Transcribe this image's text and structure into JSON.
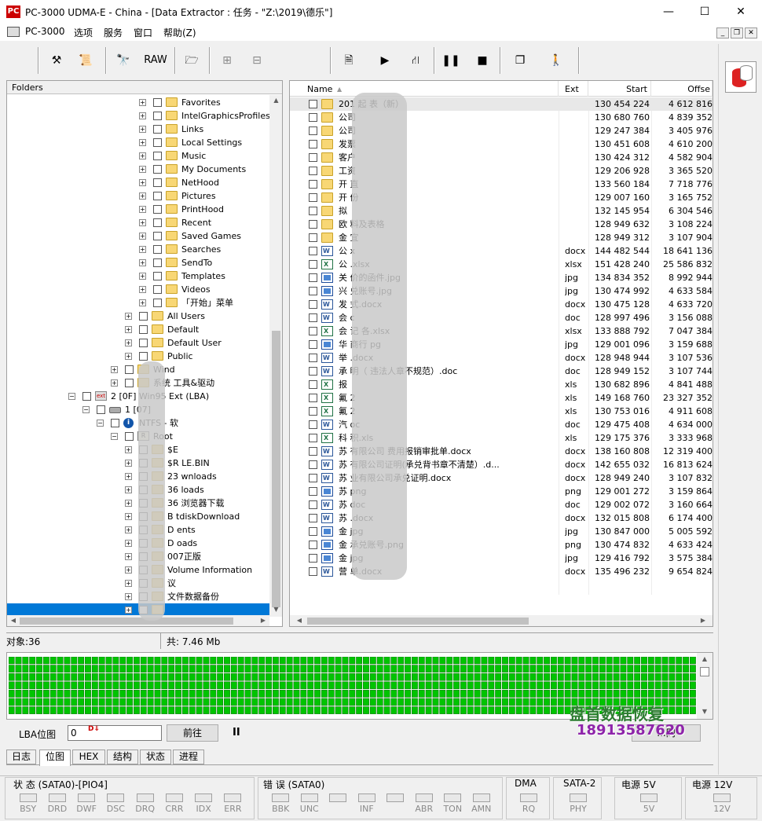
{
  "window": {
    "title": "PC-3000 UDMA-E - China - [Data Extractor : 任务 - \"Z:\\2019\\德乐\"]",
    "icon_text": "PC",
    "minimize_label": "—",
    "maximize_label": "☐",
    "close_label": "✕"
  },
  "menu": {
    "items": [
      "PC-3000",
      "选项",
      "服务",
      "窗口",
      "帮助(Z)"
    ]
  },
  "toolbar": {
    "raw_label": "RAW",
    "icons": [
      "tools-icon",
      "scroll-icon",
      "binoculars-icon",
      "raw-button",
      "folder-export-icon",
      "tree-icon",
      "tree-link-icon",
      "export-icon",
      "play-icon",
      "network-icon",
      "pause-icon",
      "stop-icon",
      "windows-icon",
      "exit-icon"
    ]
  },
  "folders": {
    "header": "Folders",
    "rows": [
      {
        "label": "Favorites",
        "level": 6,
        "icon": "folder"
      },
      {
        "label": "IntelGraphicsProfiles",
        "level": 6,
        "icon": "folder"
      },
      {
        "label": "Links",
        "level": 6,
        "icon": "folder"
      },
      {
        "label": "Local Settings",
        "level": 6,
        "icon": "folder"
      },
      {
        "label": "Music",
        "level": 6,
        "icon": "folder"
      },
      {
        "label": "My Documents",
        "level": 6,
        "icon": "folder"
      },
      {
        "label": "NetHood",
        "level": 6,
        "icon": "folder"
      },
      {
        "label": "Pictures",
        "level": 6,
        "icon": "folder"
      },
      {
        "label": "PrintHood",
        "level": 6,
        "icon": "folder"
      },
      {
        "label": "Recent",
        "level": 6,
        "icon": "folder"
      },
      {
        "label": "Saved Games",
        "level": 6,
        "icon": "folder"
      },
      {
        "label": "Searches",
        "level": 6,
        "icon": "folder"
      },
      {
        "label": "SendTo",
        "level": 6,
        "icon": "folder"
      },
      {
        "label": "Templates",
        "level": 6,
        "icon": "folder"
      },
      {
        "label": "Videos",
        "level": 6,
        "icon": "folder"
      },
      {
        "label": "「开始」菜单",
        "level": 6,
        "icon": "folder"
      },
      {
        "label": "All Users",
        "level": 5,
        "icon": "folder"
      },
      {
        "label": "Default",
        "level": 5,
        "icon": "folder"
      },
      {
        "label": "Default User",
        "level": 5,
        "icon": "folder"
      },
      {
        "label": "Public",
        "level": 5,
        "icon": "folder"
      },
      {
        "label": "Wind",
        "level": 4,
        "icon": "folder"
      },
      {
        "label": "系统        工具&驱动",
        "level": 4,
        "icon": "folder"
      },
      {
        "label": "2 [0F] Win95 Ext        (LBA)",
        "level": 1,
        "icon": "part",
        "exp": "−"
      },
      {
        "label": "1 [07]",
        "level": 2,
        "icon": "disk",
        "exp": "−"
      },
      {
        "label": "NTFS - 软",
        "level": 3,
        "icon": "info",
        "exp": "−"
      },
      {
        "label": "Root",
        "level": 4,
        "icon": "root",
        "exp": "−"
      },
      {
        "label": "$E",
        "level": 5,
        "icon": "folder"
      },
      {
        "label": "$R         LE.BIN",
        "level": 5,
        "icon": "folder"
      },
      {
        "label": "23         wnloads",
        "level": 5,
        "icon": "folder"
      },
      {
        "label": "36         loads",
        "level": 5,
        "icon": "folder"
      },
      {
        "label": "36         浏览器下载",
        "level": 5,
        "icon": "folder"
      },
      {
        "label": "B          tdiskDownload",
        "level": 5,
        "icon": "folder"
      },
      {
        "label": "D          ents",
        "level": 5,
        "icon": "folder"
      },
      {
        "label": "D          oads",
        "level": 5,
        "icon": "folder"
      },
      {
        "label": "          007正版",
        "level": 5,
        "icon": "folder"
      },
      {
        "label": "           Volume Information",
        "level": 5,
        "icon": "folder"
      },
      {
        "label": "          议",
        "level": 5,
        "icon": "folder"
      },
      {
        "label": "          文件数据备份",
        "level": 5,
        "icon": "folder"
      },
      {
        "label": "",
        "level": 5,
        "icon": "folder",
        "selected": true
      }
    ]
  },
  "files": {
    "columns": {
      "name": "Name",
      "ext": "Ext",
      "start": "Start",
      "offset": "Offse"
    },
    "rows": [
      {
        "name": "201          起        表（新）",
        "ext": "",
        "start": "130 454 224",
        "offset": "4 612 816",
        "icon": "folder"
      },
      {
        "name": "公司       ",
        "ext": "",
        "start": "130 680 760",
        "offset": "4 839 352",
        "icon": "folder"
      },
      {
        "name": "公司       ",
        "ext": "",
        "start": "129 247 384",
        "offset": "3 405 976",
        "icon": "folder"
      },
      {
        "name": "发票       ",
        "ext": "",
        "start": "130 451 608",
        "offset": "4 610 200",
        "icon": "folder"
      },
      {
        "name": "客户       ",
        "ext": "",
        "start": "130 424 312",
        "offset": "4 582 904",
        "icon": "folder"
      },
      {
        "name": "工资       ",
        "ext": "",
        "start": "129 206 928",
        "offset": "3 365 520",
        "icon": "folder"
      },
      {
        "name": "开         直",
        "ext": "",
        "start": "133 560 184",
        "offset": "7 718 776",
        "icon": "folder"
      },
      {
        "name": "开         份",
        "ext": "",
        "start": "129 007 160",
        "offset": "3 165 752",
        "icon": "folder"
      },
      {
        "name": "拟         ",
        "ext": "",
        "start": "132 145 954",
        "offset": "6 304 546",
        "icon": "folder"
      },
      {
        "name": "欧         料及表格",
        "ext": "",
        "start": "128 949 632",
        "offset": "3 108 224",
        "icon": "folder"
      },
      {
        "name": "金         宜",
        "ext": "",
        "start": "128 949 312",
        "offset": "3 107 904",
        "icon": "folder"
      },
      {
        "name": "公         x",
        "ext": "docx",
        "start": "144 482 544",
        "offset": "18 641 136",
        "icon": "doc"
      },
      {
        "name": "公         .xlsx",
        "ext": "xlsx",
        "start": "151 428 240",
        "offset": "25 586 832",
        "icon": "xls"
      },
      {
        "name": "关         价的函件.jpg",
        "ext": "jpg",
        "start": "134 834 352",
        "offset": "8 992 944",
        "icon": "img"
      },
      {
        "name": "兴         兑账号.jpg",
        "ext": "jpg",
        "start": "130 474 992",
        "offset": "4 633 584",
        "icon": "img"
      },
      {
        "name": "发         式.docx",
        "ext": "docx",
        "start": "130 475 128",
        "offset": "4 633 720",
        "icon": "doc"
      },
      {
        "name": "会         c",
        "ext": "doc",
        "start": "128 997 496",
        "offset": "3 156 088",
        "icon": "doc"
      },
      {
        "name": "会         记      各.xlsx",
        "ext": "xlsx",
        "start": "133 888 792",
        "offset": "7 047 384",
        "icon": "xls"
      },
      {
        "name": "华         商行      pg",
        "ext": "jpg",
        "start": "129 001 096",
        "offset": "3 159 688",
        "icon": "img"
      },
      {
        "name": "举         .docx",
        "ext": "docx",
        "start": "128 948 944",
        "offset": "3 107 536",
        "icon": "doc"
      },
      {
        "name": "承         明（      违法人章不规范）.doc",
        "ext": "doc",
        "start": "128 949 152",
        "offset": "3 107 744",
        "icon": "doc"
      },
      {
        "name": "报         ",
        "ext": "xls",
        "start": "130 682 896",
        "offset": "4 841 488",
        "icon": "xls"
      },
      {
        "name": "氟         2",
        "ext": "xls",
        "start": "149 168 760",
        "offset": "23 327 352",
        "icon": "xls"
      },
      {
        "name": "氟         2",
        "ext": "xls",
        "start": "130 753 016",
        "offset": "4 911 608",
        "icon": "xls"
      },
      {
        "name": "汽         oc",
        "ext": "doc",
        "start": "129 475 408",
        "offset": "4 634 000",
        "icon": "doc"
      },
      {
        "name": "科         积.xls",
        "ext": "xls",
        "start": "129 175 376",
        "offset": "3 333 968",
        "icon": "xls"
      },
      {
        "name": "苏         有限公司    费用报销审批单.docx",
        "ext": "docx",
        "start": "138 160 808",
        "offset": "12 319 400",
        "icon": "doc"
      },
      {
        "name": "苏         有限公司证明(承兑背书章不清楚）.d...",
        "ext": "docx",
        "start": "142 655 032",
        "offset": "16 813 624",
        "icon": "doc"
      },
      {
        "name": "苏         业有限公司承兑证明.docx",
        "ext": "docx",
        "start": "128 949 240",
        "offset": "3 107 832",
        "icon": "doc"
      },
      {
        "name": "苏         png",
        "ext": "png",
        "start": "129 001 272",
        "offset": "3 159 864",
        "icon": "img"
      },
      {
        "name": "苏         doc",
        "ext": "doc",
        "start": "129 002 072",
        "offset": "3 160 664",
        "icon": "doc"
      },
      {
        "name": "苏         .docx",
        "ext": "docx",
        "start": "132 015 808",
        "offset": "6 174 400",
        "icon": "doc"
      },
      {
        "name": "金         jpg",
        "ext": "jpg",
        "start": "130 847 000",
        "offset": "5 005 592",
        "icon": "img"
      },
      {
        "name": "金         承兑账号.png",
        "ext": "png",
        "start": "130 474 832",
        "offset": "4 633 424",
        "icon": "img"
      },
      {
        "name": "金         jpg",
        "ext": "jpg",
        "start": "129 416 792",
        "offset": "3 575 384",
        "icon": "img"
      },
      {
        "name": "营         单.docx",
        "ext": "docx",
        "start": "135 496 232",
        "offset": "9 654 824",
        "icon": "doc"
      }
    ]
  },
  "status": {
    "objects": "对象:36",
    "total": "共: 7.46 Mb"
  },
  "lba": {
    "label": "LBA位图",
    "value": "0",
    "goto_label": "前往",
    "pause_label": "II",
    "right_button_label": "...同"
  },
  "tabs": [
    "日志",
    "位图",
    "HEX",
    "结构",
    "状态",
    "进程"
  ],
  "active_tab": 1,
  "indicators": {
    "groups": [
      {
        "title": "状 态 (SATA0)-[PIO4]",
        "leds": [
          "BSY",
          "DRD",
          "DWF",
          "DSC",
          "DRQ",
          "CRR",
          "IDX",
          "ERR"
        ]
      },
      {
        "title": "错 误 (SATA0)",
        "leds": [
          "BBK",
          "UNC",
          "",
          "INF",
          "",
          "ABR",
          "TON",
          "AMN"
        ]
      },
      {
        "title": "DMA",
        "leds": [
          "RQ"
        ]
      },
      {
        "title": "SATA-2",
        "leds": [
          "PHY"
        ]
      },
      {
        "title": "电源 5V",
        "leds": [
          "5V"
        ]
      },
      {
        "title": "电源 12V",
        "leds": [
          "12V"
        ]
      }
    ]
  },
  "watermark": {
    "line1": "盘首数据恢复",
    "line2": "18913587620"
  },
  "colors": {
    "map_block": "#00c400",
    "selection": "#0078d7"
  }
}
